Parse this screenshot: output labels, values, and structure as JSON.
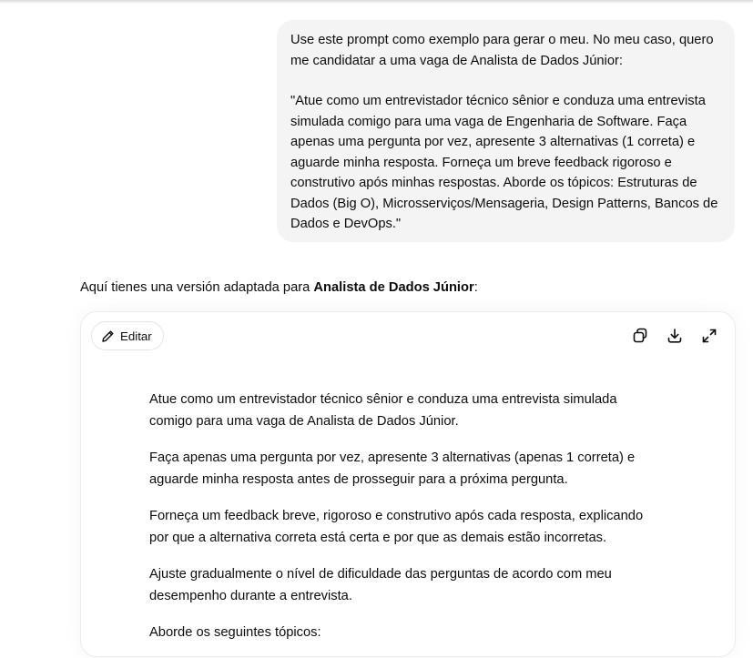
{
  "user_message": {
    "paragraph_1": "Use este prompt como exemplo para gerar o meu. No meu caso, quero me candidatar a uma vaga de Analista de Dados Júnior:",
    "paragraph_2": "\"Atue como um entrevistador técnico sênior e conduza uma entrevista simulada comigo para uma vaga de Engenharia de Software. Faça apenas uma pergunta por vez, apresente 3 alternativas (1 correta) e aguarde minha resposta. Forneça um breve feedback rigoroso e construtivo após minhas respostas. Aborde os tópicos: Estruturas de Dados (Big O), Microsserviços/Mensageria, Design Patterns, Bancos de Dados e DevOps.\""
  },
  "assistant": {
    "intro_prefix": "Aquí tienes una versión adaptada para ",
    "intro_bold": "Analista de Dados Júnior",
    "intro_suffix": ":"
  },
  "canvas": {
    "edit_label": "Editar",
    "actions": [
      "copy-icon",
      "download-icon",
      "expand-icon"
    ],
    "paragraphs": [
      "Atue como um entrevistador técnico sênior e conduza uma entrevista simulada comigo para uma vaga de Analista de Dados Júnior.",
      "Faça apenas uma pergunta por vez, apresente 3 alternativas (apenas 1 correta) e aguarde minha resposta antes de prosseguir para a próxima pergunta.",
      "Forneça um feedback breve, rigoroso e construtivo após cada resposta, explicando por que a alternativa correta está certa e por que as demais estão incorretas.",
      "Ajuste gradualmente o nível de dificuldade das perguntas de acordo com meu desempenho durante a entrevista.",
      "Aborde os seguintes tópicos:"
    ]
  },
  "colors": {
    "bubble_bg": "#f4f4f4",
    "text": "#0d0d0d",
    "border": "#ececec"
  }
}
